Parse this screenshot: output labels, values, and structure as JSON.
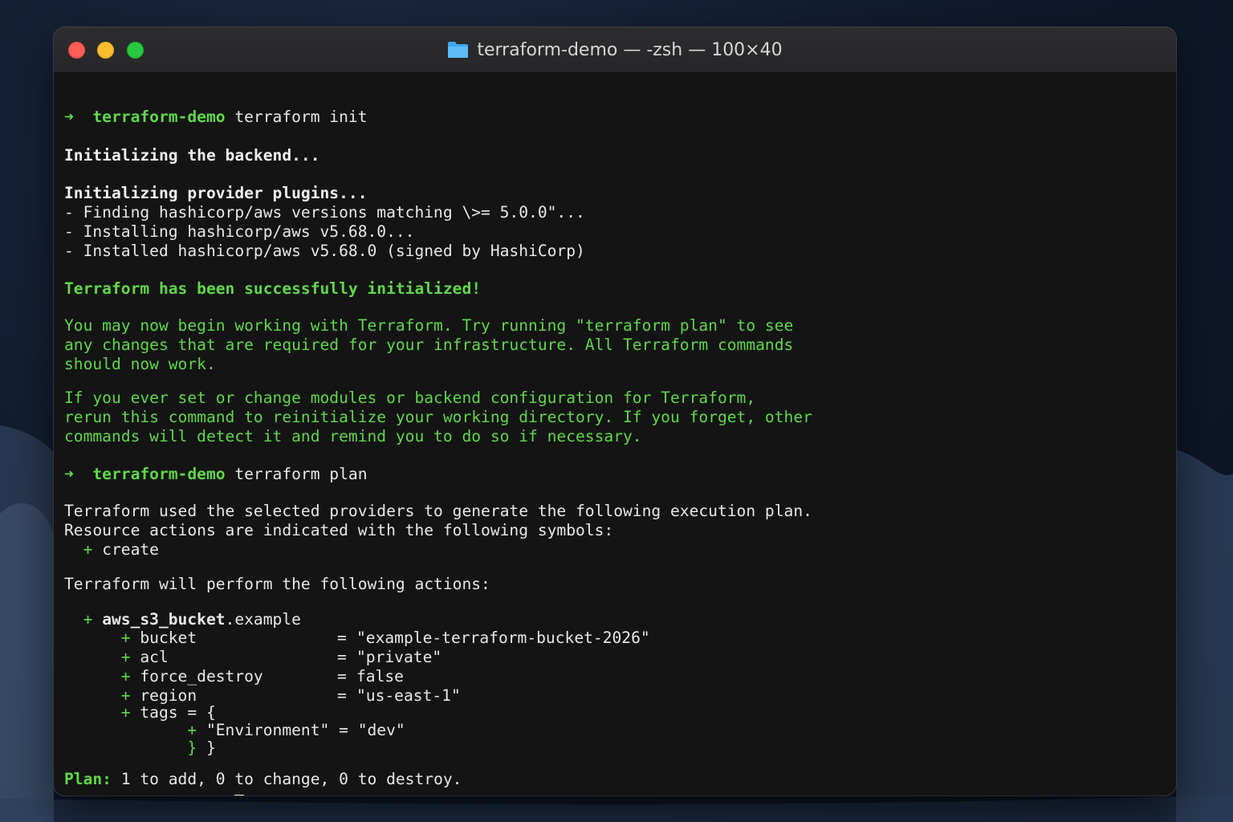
{
  "window": {
    "title": "terraform-demo — -zsh — 100×40"
  },
  "terminal": {
    "prompt_arrow": "➜",
    "prompt_dir": "terraform-demo",
    "cmd_init": "terraform init",
    "backend": "Initializing the backend...",
    "provider_plugins": "Initializing provider plugins...",
    "finding": "- Finding hashicorp/aws versions matching \\>= 5.0.0\"...",
    "installing": "- Installing hashicorp/aws v5.68.0...",
    "installed": "- Installed hashicorp/aws v5.68.0 (signed by HashiCorp)",
    "success": "Terraform has been successfully initialized!",
    "may_now_1": "You may now begin working with Terraform. Try running \"terraform plan\" to see",
    "may_now_2": "any changes that are required for your infrastructure. All Terraform commands",
    "may_now_3": "should now work.",
    "if_you_1": "If you ever set or change modules or backend configuration for Terraform,",
    "if_you_2": "rerun this command to reinitialize your working directory. If you forget, other",
    "if_you_3": "commands will detect it and remind you to do so if necessary.",
    "cmd_plan": "terraform plan",
    "used_selected": "Terraform used the selected providers to generate the following execution plan.",
    "resource_actions": "Resource actions are indicated with the following symbols:",
    "create_label": "create",
    "will_perform": "Terraform will perform the following actions:",
    "resource_type": "aws_s3_bucket",
    "resource_name": ".example",
    "attributes": [
      {
        "key": "bucket",
        "eq": "= ",
        "value": "\"example-terraform-bucket-2026\""
      },
      {
        "key": "acl",
        "eq": "= ",
        "value": "\"private\""
      },
      {
        "key": "force_destroy",
        "eq": "= ",
        "value": "false"
      },
      {
        "key": "region",
        "eq": "= ",
        "value": "\"us-east-1\""
      }
    ],
    "tags_open": "tags = {",
    "tag_entry": "\"Environment\" = \"dev\"",
    "tag_close_brace": "}",
    "tag_close": " }",
    "plus": "+",
    "plan_label": "Plan:",
    "plan_summary": " 1 to add, 0 to change, 0 to destroy."
  },
  "colors": {
    "green": "#5fd84a",
    "background": "#141414",
    "text": "#e8e8e8"
  },
  "icons": {
    "title_folder": "folder-icon"
  }
}
